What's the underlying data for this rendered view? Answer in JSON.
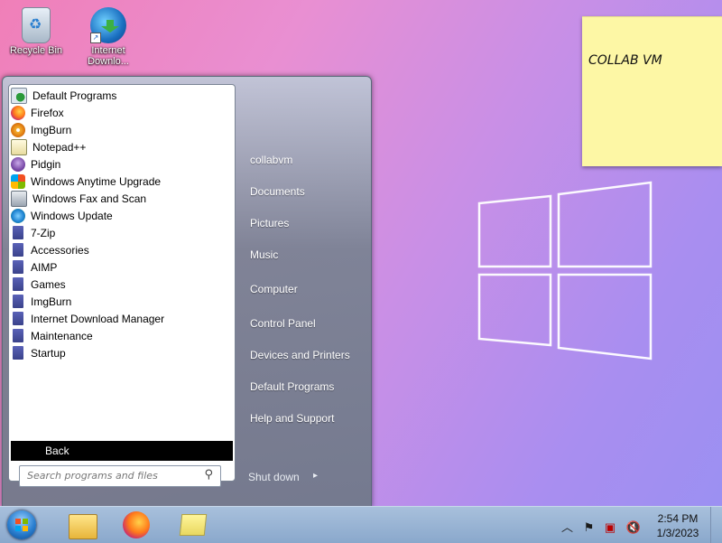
{
  "desktop": {
    "icons": [
      {
        "label": "Recycle Bin"
      },
      {
        "label": "Internet Downlo..."
      }
    ],
    "sticky_note": {
      "text": "COLLAB VM"
    }
  },
  "start_menu": {
    "programs": [
      {
        "label": "Default Programs",
        "icon": "default-programs-icon"
      },
      {
        "label": "Firefox",
        "icon": "firefox-icon"
      },
      {
        "label": "ImgBurn",
        "icon": "imgburn-icon"
      },
      {
        "label": "Notepad++",
        "icon": "notepadpp-icon"
      },
      {
        "label": "Pidgin",
        "icon": "pidgin-icon"
      },
      {
        "label": "Windows Anytime Upgrade",
        "icon": "anytime-upgrade-icon"
      },
      {
        "label": "Windows Fax and Scan",
        "icon": "fax-scan-icon"
      },
      {
        "label": "Windows Update",
        "icon": "windows-update-icon"
      },
      {
        "label": "7-Zip",
        "icon": "folder-icon"
      },
      {
        "label": "Accessories",
        "icon": "folder-icon"
      },
      {
        "label": "AIMP",
        "icon": "folder-icon"
      },
      {
        "label": "Games",
        "icon": "folder-icon"
      },
      {
        "label": "ImgBurn",
        "icon": "folder-icon"
      },
      {
        "label": "Internet Download Manager",
        "icon": "folder-icon"
      },
      {
        "label": "Maintenance",
        "icon": "folder-icon"
      },
      {
        "label": "Startup",
        "icon": "folder-icon"
      }
    ],
    "back_label": "Back",
    "search_placeholder": "Search programs and files",
    "right_items": [
      {
        "label": "collabvm"
      },
      {
        "label": "Documents"
      },
      {
        "label": "Pictures"
      },
      {
        "label": "Music"
      },
      {
        "label": "Computer"
      },
      {
        "label": "Control Panel"
      },
      {
        "label": "Devices and Printers"
      },
      {
        "label": "Default Programs"
      },
      {
        "label": "Help and Support"
      }
    ],
    "shutdown_label": "Shut down"
  },
  "taskbar": {
    "pinned": [
      {
        "name": "windows-explorer"
      },
      {
        "name": "firefox"
      },
      {
        "name": "sticky-notes"
      }
    ],
    "clock": {
      "time": "2:54 PM",
      "date": "1/3/2023"
    }
  }
}
